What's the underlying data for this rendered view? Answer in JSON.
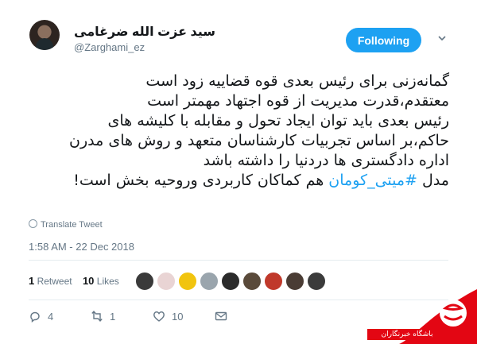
{
  "tweet": {
    "author_name": "سید عزت الله ضرغامی",
    "handle": "@Zarghami_ez",
    "follow_label": "Following",
    "lines": [
      "گمانه‌زنی برای رئیس بعدی قوه قضاییه زود است",
      "معتقدم،قدرت مدیریت از قوه اجتهاد مهمتر است",
      "رئیس بعدی باید توان ایجاد تحول و مقابله با کلیشه های",
      "حاکم،بر اساس تجربیات کارشناسان متعهد و روش های مدرن",
      "اداره دادگستری ها دردنیا را داشته باشد"
    ],
    "last_line_prefix": "مدل",
    "hashtag": "#میتی_کومان",
    "last_line_suffix": "هم کماکان کاربردی وروحیه بخش است!",
    "translate_label": "Translate Tweet",
    "timestamp": "1:58 AM - 22 Dec 2018",
    "retweets_count": "1",
    "retweets_label": "Retweet",
    "likes_count": "10",
    "likes_label": "Likes",
    "reply_count": "4",
    "retweet_action_count": "1",
    "like_action_count": "10"
  },
  "watermark": {
    "text": "باشگاه خبرنگاران"
  },
  "colors": {
    "accent": "#1da1f2",
    "muted": "#657786",
    "brand_red": "#e30613"
  }
}
